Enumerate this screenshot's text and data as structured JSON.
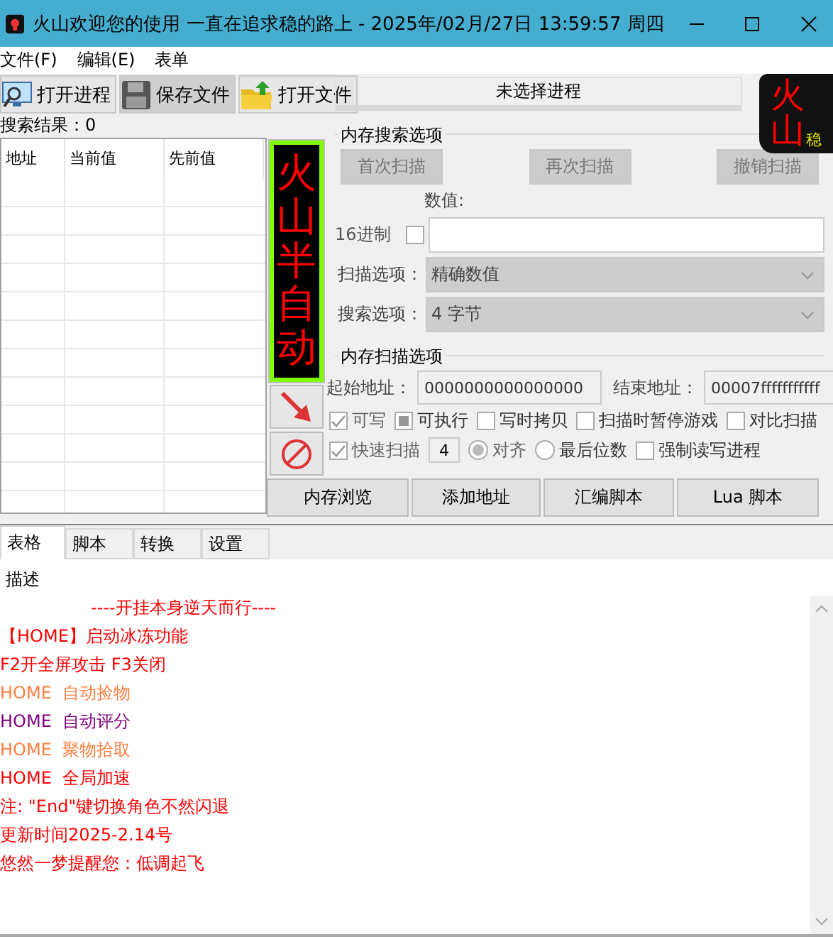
{
  "window": {
    "title": "火山欢迎您的使用 一直在追求稳的路上  - 2025年/02月/27日 13:59:57 周四"
  },
  "menu": [
    {
      "label": "文件(F)"
    },
    {
      "label": "编辑(E)"
    },
    {
      "label": "表单"
    }
  ],
  "toolbar": [
    {
      "kind": "monitor",
      "label": "打开进程",
      "pressed": false
    },
    {
      "kind": "floppy",
      "label": "保存文件",
      "pressed": true
    },
    {
      "kind": "folder",
      "label": "打开文件",
      "pressed": false
    }
  ],
  "process_bar": {
    "label": "未选择进程"
  },
  "logo": {
    "text": "火山",
    "badge": "稳"
  },
  "results": {
    "label": "搜索结果：0"
  },
  "table": {
    "columns": [
      "地址",
      "当前值",
      "先前值"
    ]
  },
  "banner": {
    "text": "火山半自动"
  },
  "side_buttons": [
    {
      "kind": "arrow"
    },
    {
      "kind": "forbid"
    }
  ],
  "search_options": {
    "title": "内存搜索选项",
    "buttons": [
      {
        "label": "首次扫描",
        "disabled": true
      },
      {
        "label": "再次扫描",
        "disabled": true
      },
      {
        "label": "撤销扫描",
        "disabled": true
      }
    ],
    "value_label": "数值:",
    "hex": {
      "label": "16进制",
      "checked": false
    },
    "selects": [
      {
        "label": "扫描选项：",
        "value": "精确数值"
      },
      {
        "label": "搜索选项：",
        "value": "4 字节"
      }
    ]
  },
  "scan_options": {
    "title": "内存扫描选项",
    "start": {
      "label": "起始地址：",
      "value": "0000000000000000"
    },
    "end": {
      "label": "结束地址：",
      "value": "00007fffffffffff"
    },
    "checks": [
      {
        "label": "可写",
        "checked": true,
        "indeterminate": false,
        "disabled": true
      },
      {
        "label": "可执行",
        "checked": false,
        "indeterminate": true,
        "disabled": false
      },
      {
        "label": "写时拷贝",
        "checked": false,
        "indeterminate": false,
        "disabled": false
      },
      {
        "label": "扫描时暂停游戏",
        "checked": false,
        "indeterminate": false,
        "disabled": false
      },
      {
        "label": "对比扫描",
        "checked": false,
        "indeterminate": false,
        "disabled": false
      }
    ],
    "fast_row": [
      {
        "kind": "checkbox",
        "label": "快速扫描",
        "checked": true,
        "indeterminate": false,
        "disabled": true
      },
      {
        "kind": "field",
        "value": "4"
      },
      {
        "kind": "radio",
        "label": "对齐",
        "selected": true,
        "disabled": true
      },
      {
        "kind": "radio",
        "label": "最后位数",
        "selected": false,
        "disabled": false
      },
      {
        "kind": "checkbox",
        "label": "强制读写进程",
        "checked": false,
        "indeterminate": false,
        "disabled": false
      }
    ]
  },
  "action_buttons": [
    {
      "label": "内存浏览"
    },
    {
      "label": "添加地址"
    },
    {
      "label": "汇编脚本"
    },
    {
      "label": "Lua 脚本"
    }
  ],
  "tabs": [
    {
      "label": "表格",
      "selected": true
    },
    {
      "label": "脚本",
      "selected": false
    },
    {
      "label": "转换",
      "selected": false
    },
    {
      "label": "设置",
      "selected": false
    }
  ],
  "description": {
    "header": "描述",
    "lines": [
      {
        "kind": "heading",
        "text": "----开挂本身逆天而行----",
        "color": "#ff0000"
      },
      {
        "kind": "line",
        "text": "【HOME】启动冰冻功能",
        "color": "#ff0000"
      },
      {
        "kind": "line",
        "text": "F2开全屏攻击 F3关闭",
        "color": "#ff0000"
      },
      {
        "kind": "line",
        "text": "HOME  自动捡物",
        "color": "#ff8040"
      },
      {
        "kind": "line",
        "text": "HOME  自动评分",
        "color": "#800080"
      },
      {
        "kind": "line",
        "text": "HOME  聚物拾取",
        "color": "#ff8040"
      },
      {
        "kind": "line",
        "text": "HOME  全局加速",
        "color": "#ff0000"
      },
      {
        "kind": "line",
        "text": "注: \"End\"键切换角色不然闪退",
        "color": "#ff0000"
      },
      {
        "kind": "line",
        "text": "更新时间2025-2.14号",
        "color": "#ff0000"
      },
      {
        "kind": "line",
        "text": "悠然一梦提醒您：低调起飞",
        "color": "#ff0000"
      }
    ]
  }
}
